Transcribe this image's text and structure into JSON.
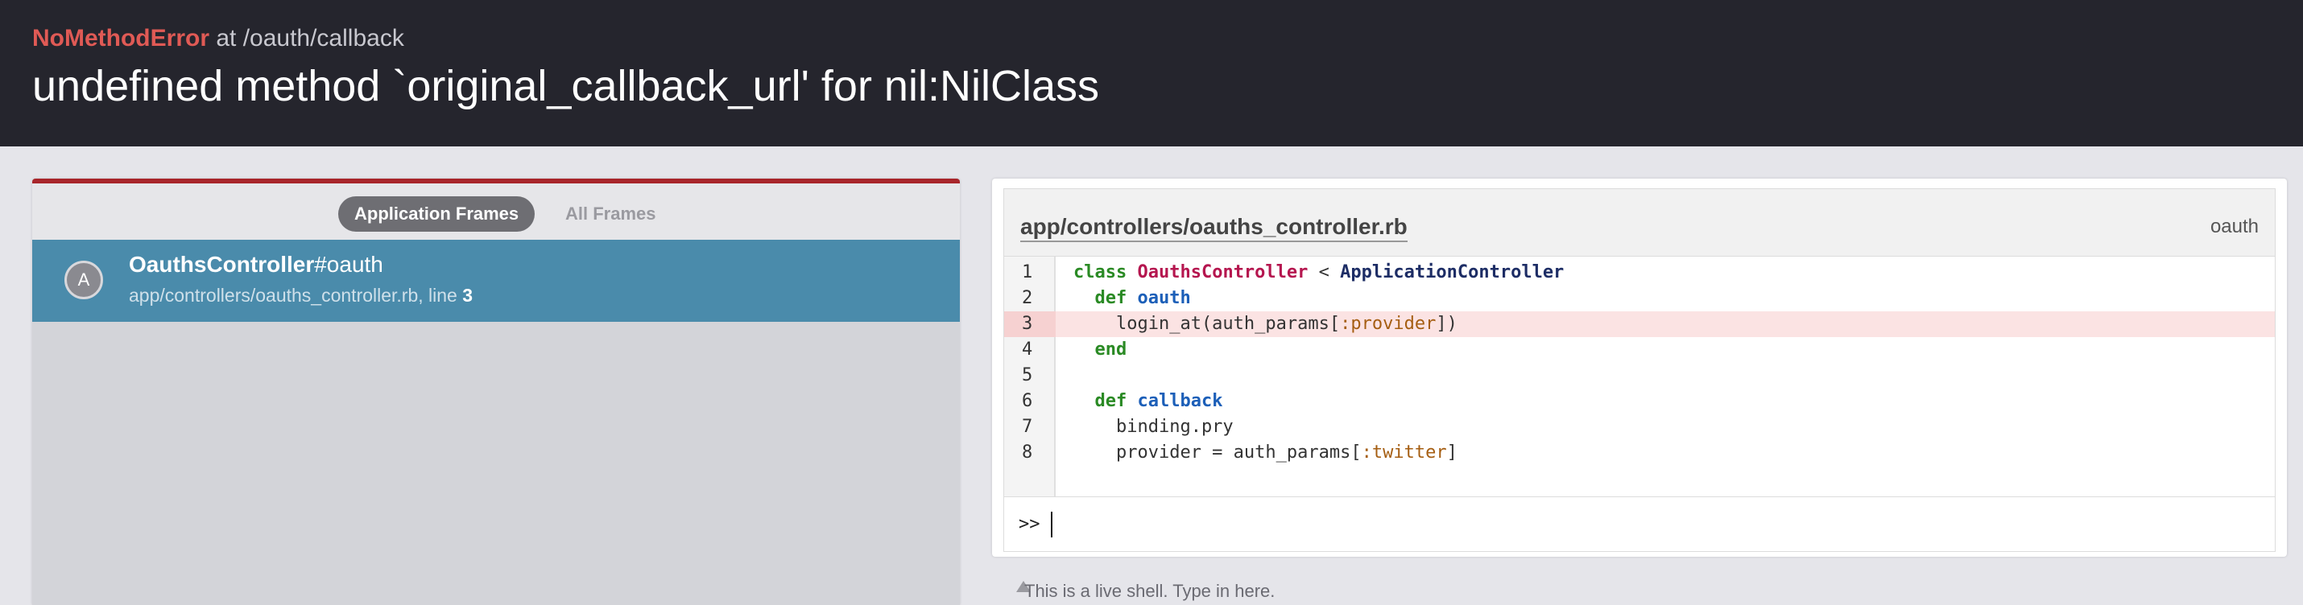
{
  "header": {
    "error_class": "NoMethodError",
    "location": " at /oauth/callback",
    "message": "undefined method `original_callback_url' for nil:NilClass"
  },
  "frames": {
    "tabs": {
      "application": "Application Frames",
      "all": "All Frames"
    },
    "items": [
      {
        "badge": "A",
        "class_name": "OauthsController",
        "method": "#oauth",
        "path": "app/controllers/oauths_controller.rb, line ",
        "line": "3"
      }
    ]
  },
  "code": {
    "file": "app/controllers/oauths_controller.rb",
    "method": "oauth",
    "highlight_line": 3,
    "lines": [
      {
        "n": "1",
        "tokens": [
          [
            "kw",
            "class "
          ],
          [
            "cls",
            "OauthsController"
          ],
          [
            "plain",
            " < "
          ],
          [
            "cls2",
            "ApplicationController"
          ]
        ]
      },
      {
        "n": "2",
        "tokens": [
          [
            "plain",
            "  "
          ],
          [
            "kw",
            "def "
          ],
          [
            "fn",
            "oauth"
          ]
        ]
      },
      {
        "n": "3",
        "tokens": [
          [
            "plain",
            "    login_at(auth_params["
          ],
          [
            "sym",
            ":provider"
          ],
          [
            "plain",
            "])"
          ]
        ]
      },
      {
        "n": "4",
        "tokens": [
          [
            "plain",
            "  "
          ],
          [
            "kw",
            "end"
          ]
        ]
      },
      {
        "n": "5",
        "tokens": []
      },
      {
        "n": "6",
        "tokens": [
          [
            "plain",
            "  "
          ],
          [
            "kw",
            "def "
          ],
          [
            "fn",
            "callback"
          ]
        ]
      },
      {
        "n": "7",
        "tokens": [
          [
            "plain",
            "    binding.pry"
          ]
        ]
      },
      {
        "n": "8",
        "tokens": [
          [
            "plain",
            "    provider = auth_params["
          ],
          [
            "sym",
            ":twitter"
          ],
          [
            "plain",
            "]"
          ]
        ]
      }
    ]
  },
  "console": {
    "prompt": ">>",
    "value": ""
  },
  "hint": "This is a live shell. Type in here."
}
